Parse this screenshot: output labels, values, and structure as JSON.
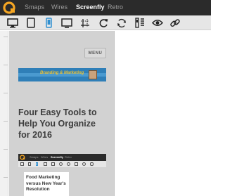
{
  "nav": {
    "logo_icon": "quirktools-logo-icon",
    "accent_color": "#f5a623",
    "items": [
      {
        "label": "Smaps",
        "active": false
      },
      {
        "label": "Wires",
        "active": false
      },
      {
        "label": "Screenfly",
        "active": true
      },
      {
        "label": "Retro",
        "active": false
      }
    ]
  },
  "toolbar": {
    "tools": [
      {
        "icon": "desktop-icon",
        "active": false
      },
      {
        "icon": "tablet-icon",
        "active": false
      },
      {
        "icon": "mobile-phone-icon",
        "active": true
      },
      {
        "icon": "television-icon",
        "active": false
      },
      {
        "icon": "custom-size-icon",
        "active": false
      },
      {
        "icon": "rotate-icon",
        "active": false
      },
      {
        "icon": "refresh-icon",
        "active": false
      },
      {
        "icon": "scrollbars-toggle-icon",
        "active": false
      },
      {
        "icon": "eye-icon",
        "active": false
      },
      {
        "icon": "link-icon",
        "active": false
      }
    ]
  },
  "preview": {
    "menu_label": "MENU",
    "banner_text": "Branding & Marketing",
    "post_title": "Four Easy Tools to Help You Organize for 2016",
    "thumbnail": {
      "nav_items": [
        "Smaps",
        "Wires",
        "Screenfly",
        "Retro"
      ],
      "text": "Food Marketing versus New Year's Resolution"
    }
  }
}
